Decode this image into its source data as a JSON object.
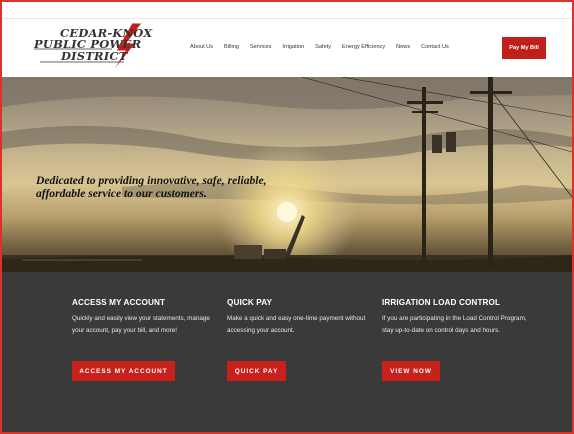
{
  "logo": {
    "line1": "CEDAR-KNOX",
    "line2": "PUBLIC POWER",
    "line3": "DISTRICT"
  },
  "nav": {
    "items": [
      "About Us",
      "Billing",
      "Services",
      "Irrigation",
      "Safety",
      "Energy Efficiency",
      "News",
      "Contact Us"
    ],
    "pay_label": "Pay My Bill"
  },
  "hero": {
    "tagline": "Dedicated to providing innovative, safe, reliable, affordable service to our customers."
  },
  "cards": [
    {
      "title": "ACCESS MY ACCOUNT",
      "text": "Quickly and easily view your statements, manage your account, pay your bill, and more!",
      "button": "ACCESS MY ACCOUNT"
    },
    {
      "title": "QUICK PAY",
      "text": "Make a quick and easy one-time payment without accessing your account.",
      "button": "QUICK PAY"
    },
    {
      "title": "IRRIGATION LOAD CONTROL",
      "text": "If you are participating in the Load Control Program, stay up-to-date on control days and hours.",
      "button": "VIEW NOW"
    }
  ],
  "colors": {
    "brand_red": "#c8211b",
    "panel_bg": "#3a3a3a"
  }
}
